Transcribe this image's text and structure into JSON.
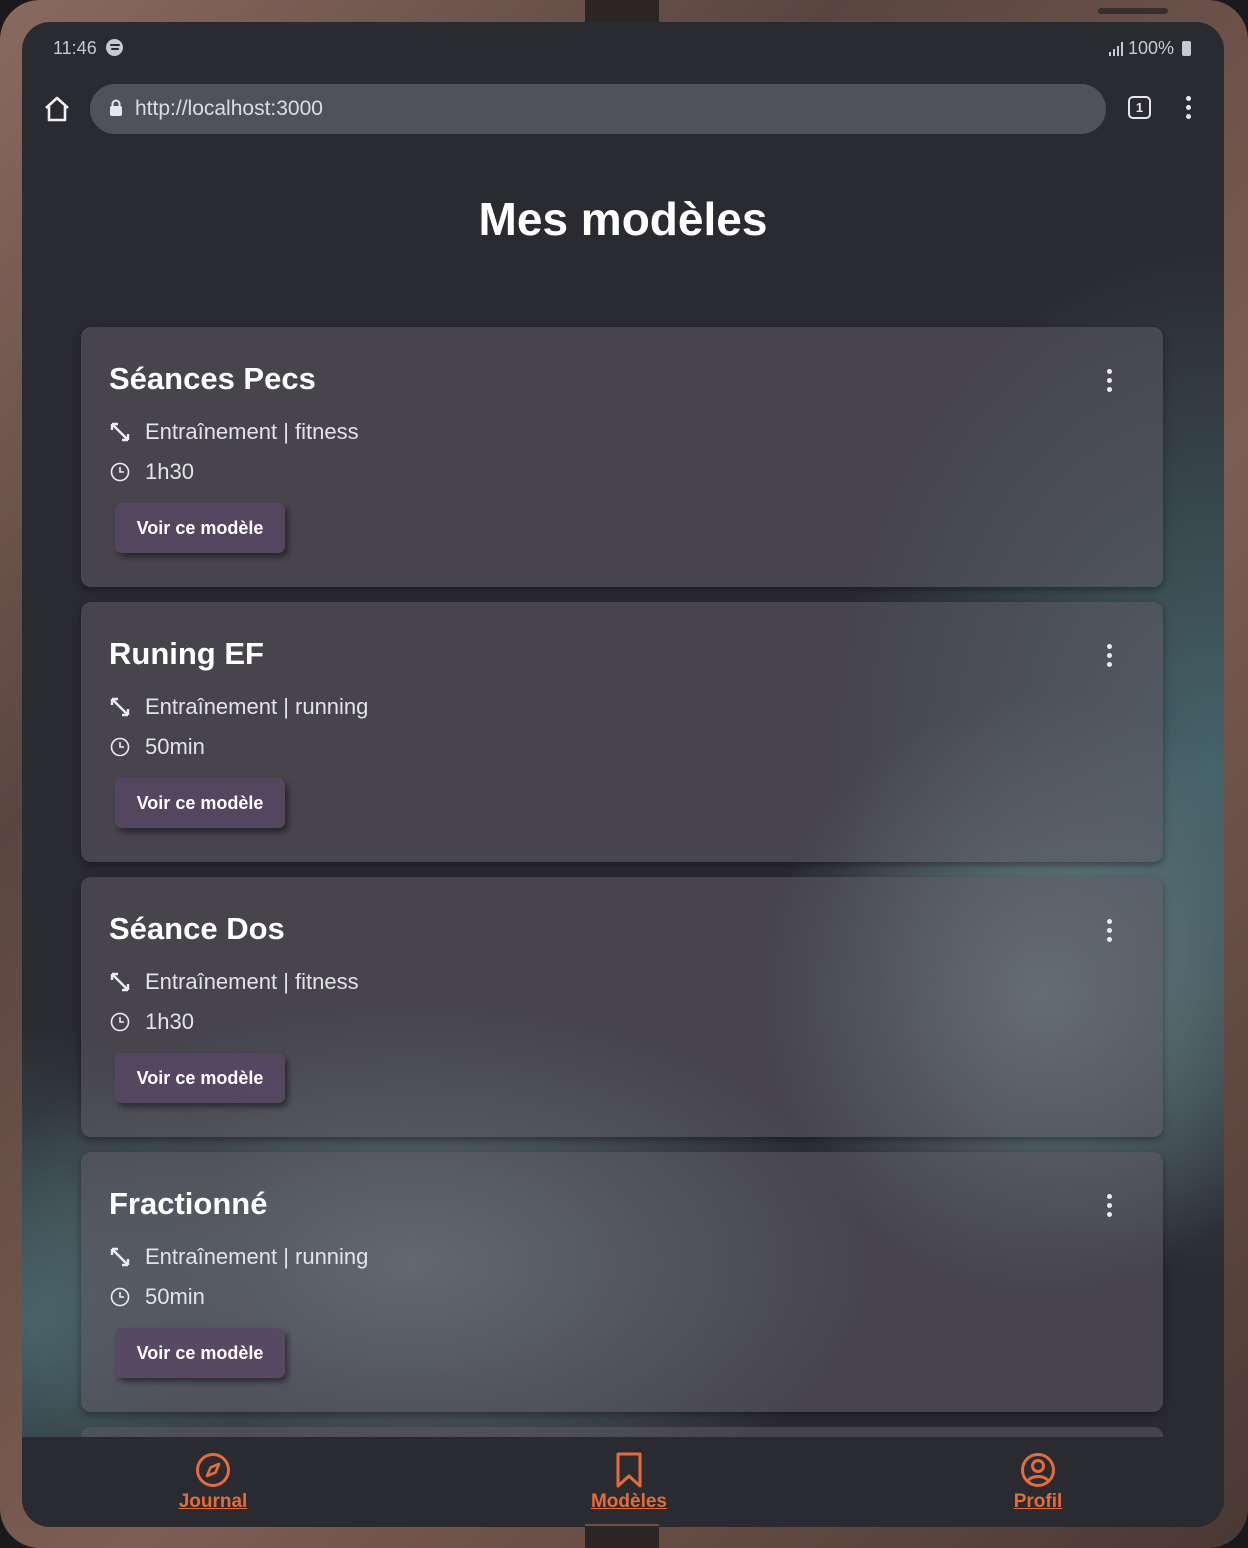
{
  "status_bar": {
    "time": "11:46",
    "battery": "100%"
  },
  "browser": {
    "url": "http://localhost:3000",
    "tab_count": "1"
  },
  "page": {
    "title": "Mes modèles"
  },
  "cards": [
    {
      "title": "Séances Pecs",
      "type": "Entraînement | fitness",
      "duration": "1h30",
      "button": "Voir ce modèle"
    },
    {
      "title": "Runing EF",
      "type": "Entraînement | running",
      "duration": "50min",
      "button": "Voir ce modèle"
    },
    {
      "title": "Séance Dos",
      "type": "Entraînement | fitness",
      "duration": "1h30",
      "button": "Voir ce modèle"
    },
    {
      "title": "Fractionné",
      "type": "Entraînement | running",
      "duration": "50min",
      "button": "Voir ce modèle"
    }
  ],
  "nav": [
    {
      "label": "Journal",
      "icon": "compass-icon"
    },
    {
      "label": "Modèles",
      "icon": "bookmark-icon"
    },
    {
      "label": "Profil",
      "icon": "user-circle-icon"
    }
  ],
  "colors": {
    "accent": "#e56b3a",
    "background": "#2a2b30",
    "button": "#584664"
  }
}
